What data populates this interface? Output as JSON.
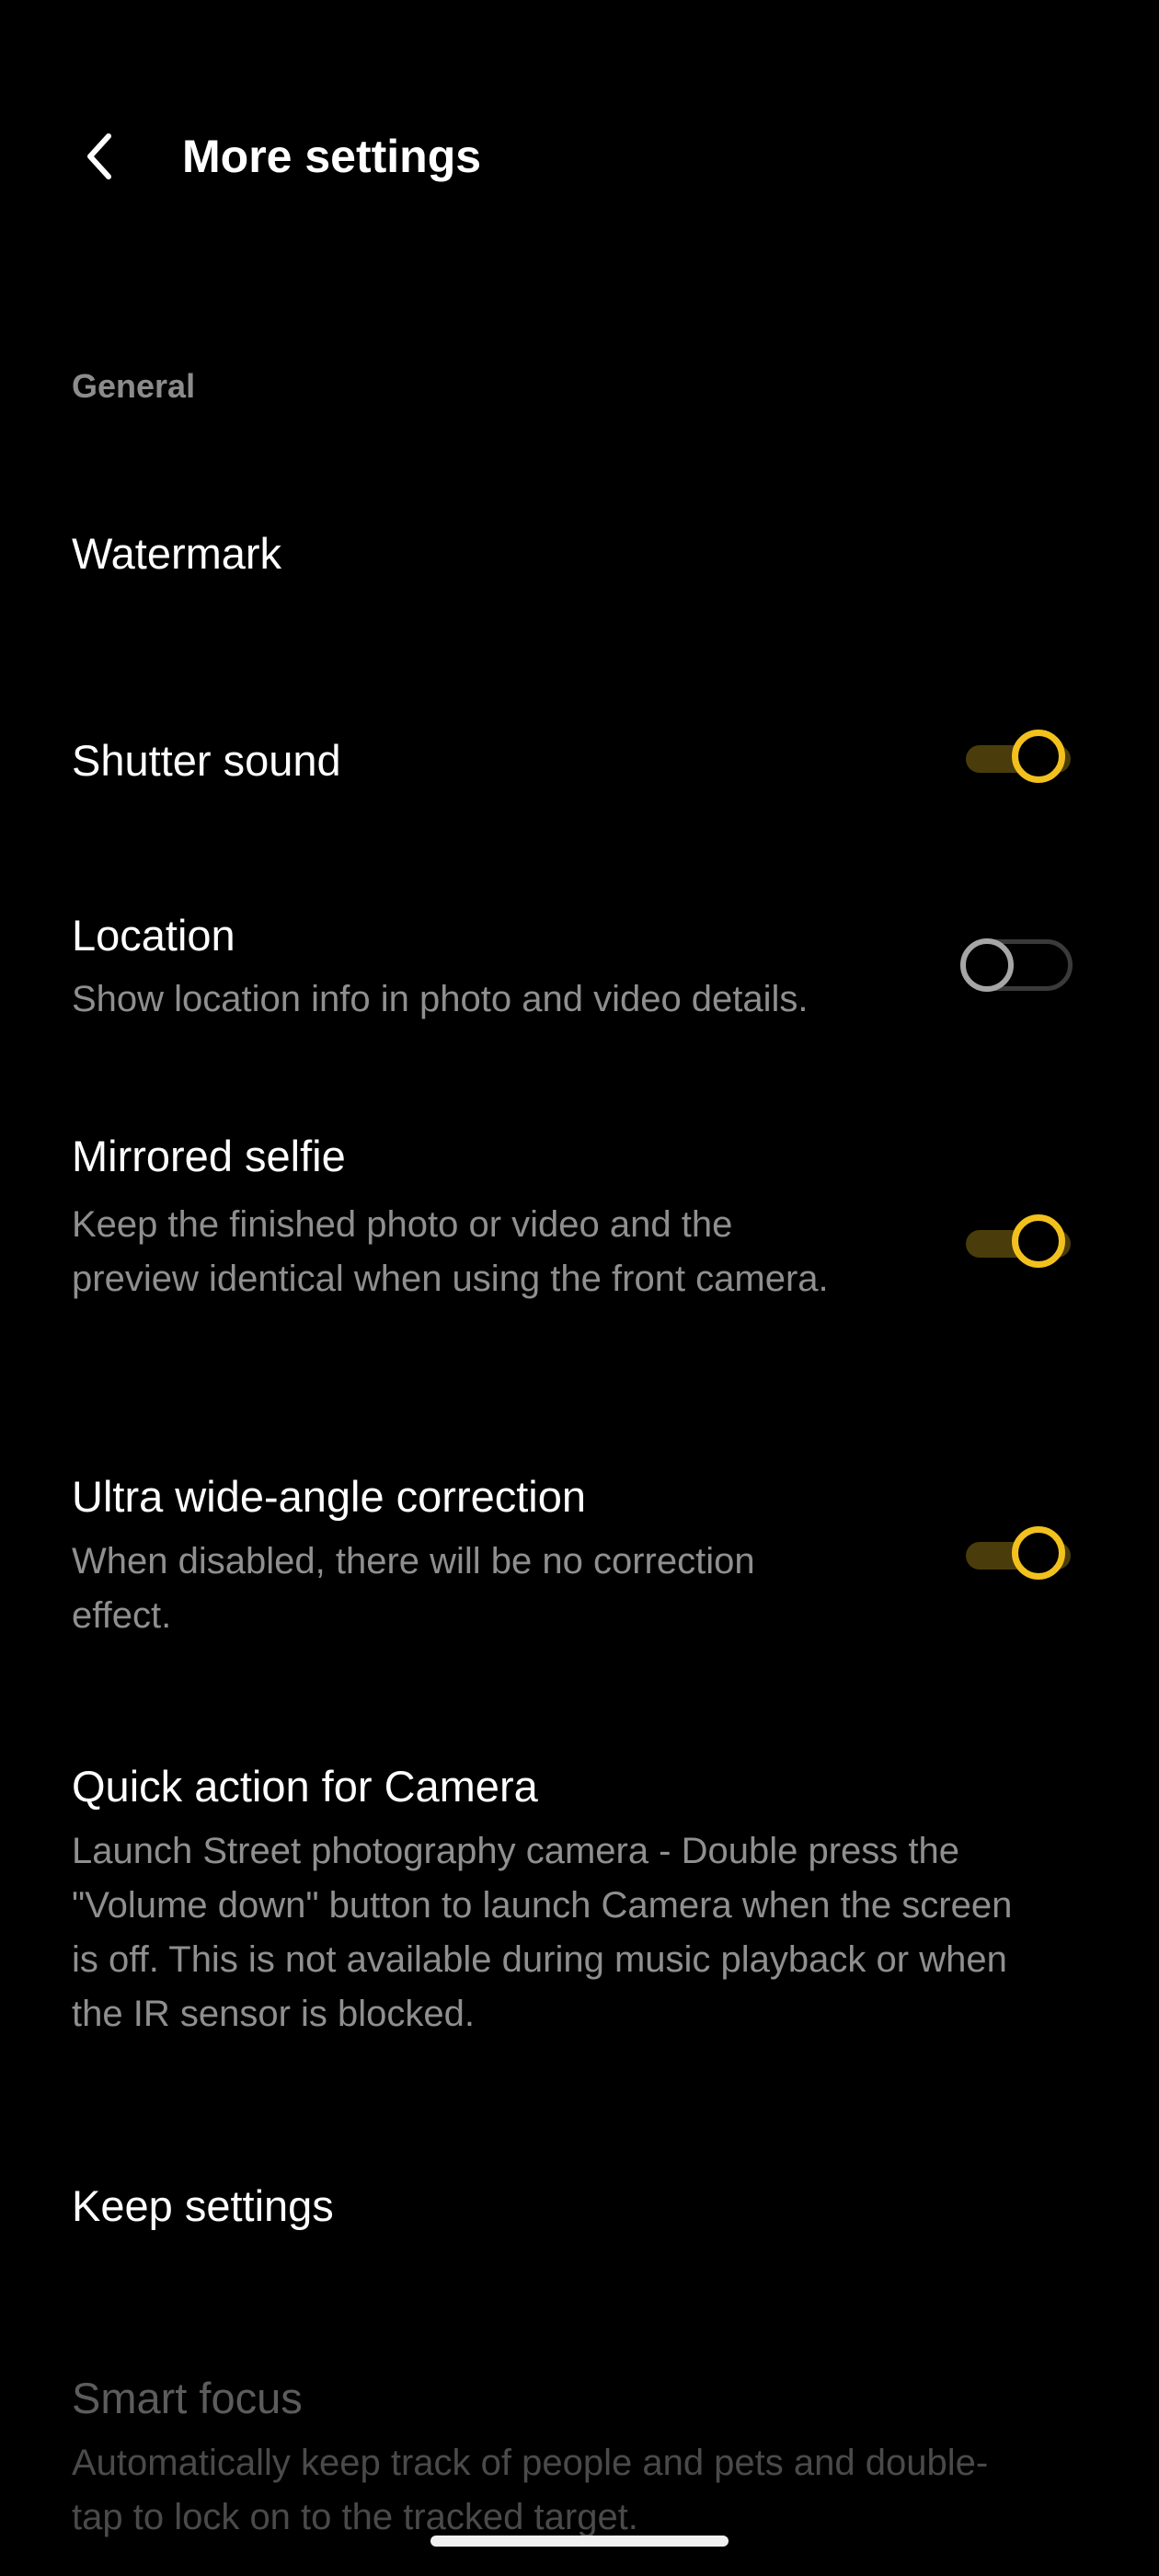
{
  "header": {
    "back_icon": "chevron-left-icon",
    "title": "More settings"
  },
  "section": {
    "label": "General"
  },
  "rows": [
    {
      "title": "Watermark"
    },
    {
      "title": "Shutter sound",
      "toggle": true
    },
    {
      "title": "Location",
      "desc": "Show location info in photo and video details.",
      "toggle": false
    },
    {
      "title": "Mirrored selfie",
      "desc": "Keep the finished photo or video and the preview identical when using the front camera.",
      "toggle": true
    },
    {
      "title": "Ultra wide-angle correction",
      "desc": "When disabled, there will be no correction effect.",
      "toggle": true
    },
    {
      "title": "Quick action for Camera",
      "desc": "Launch Street photography camera - Double press the \"Volume down\" button to launch Camera when the screen is off. This is not available during music playback or when the IR sensor is blocked."
    },
    {
      "title": "Keep settings"
    },
    {
      "title": "Smart focus",
      "desc": "Automatically keep track of people and pets and double-tap to lock on to the tracked target.",
      "disabled": true
    }
  ],
  "colors": {
    "background": "#000000",
    "accent": "#f2c11d",
    "accent_track": "#4a3d0b",
    "secondary_text": "#8f8f8f"
  }
}
